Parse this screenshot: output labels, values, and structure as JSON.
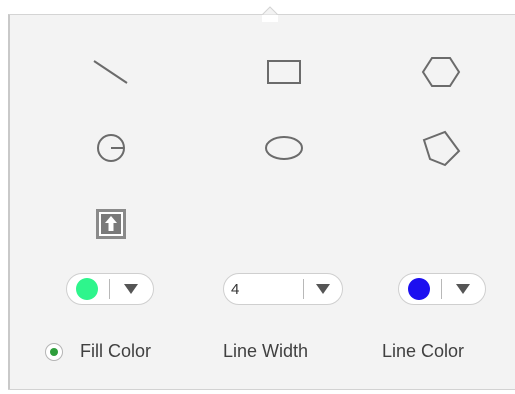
{
  "toolbar": {
    "tools": [
      {
        "name": "line-icon"
      },
      {
        "name": "rectangle-icon"
      },
      {
        "name": "hexagon-icon"
      },
      {
        "name": "circle-icon"
      },
      {
        "name": "ellipse-icon"
      },
      {
        "name": "polygon-icon"
      },
      {
        "name": "image-upload-icon"
      }
    ]
  },
  "controls": {
    "fill_color": {
      "label": "Fill Color",
      "color": "#2ef58c",
      "selected": true,
      "radio_color": "#2e9e3c"
    },
    "line_width": {
      "label": "Line Width",
      "value": "4"
    },
    "line_color": {
      "label": "Line Color",
      "color": "#1c0ff0"
    }
  },
  "colors": {
    "panel_bg": "#f3f3f3",
    "icon_stroke": "#6b6b6b",
    "label_text": "#404040"
  }
}
